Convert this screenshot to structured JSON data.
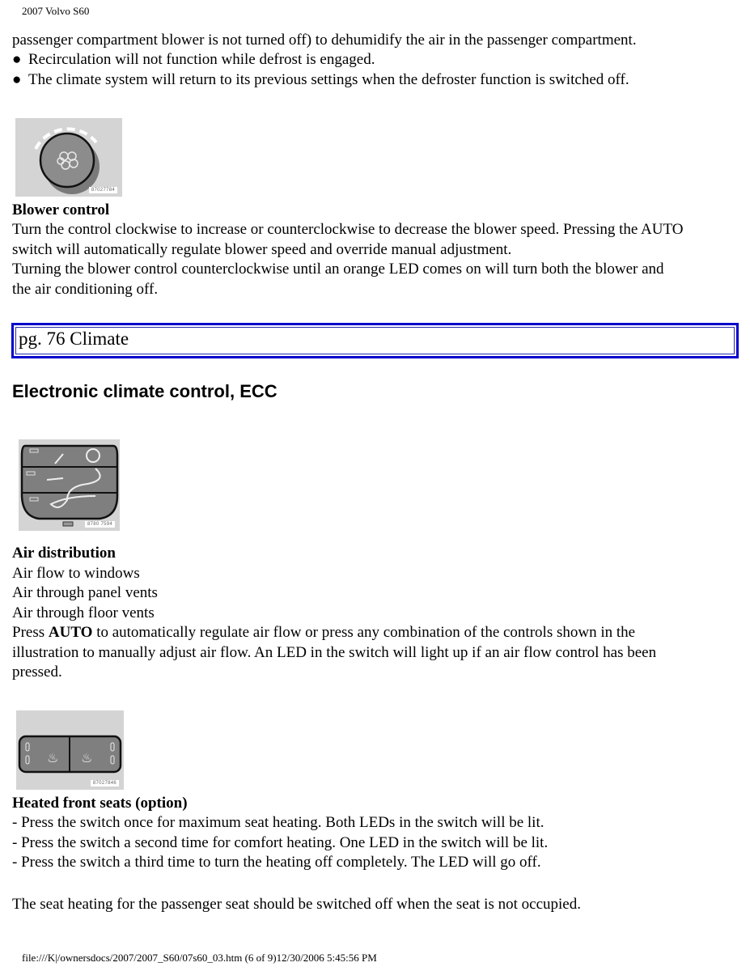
{
  "header": {
    "title": "2007 Volvo S60"
  },
  "intro": {
    "continuation": "passenger compartment blower is not turned off) to dehumidify the air in the passenger compartment.",
    "bullets": [
      "Recirculation will not function while defrost is engaged.",
      "The climate system will return to its previous settings when the defroster function is switched off."
    ]
  },
  "blower": {
    "image_code": "87027784",
    "heading": "Blower control",
    "lines": [
      "Turn the control clockwise to increase or counterclockwise to decrease the blower speed. Pressing the AUTO",
      "switch will automatically regulate blower speed and override manual adjustment.",
      "Turning the blower control counterclockwise until an orange LED comes on will turn both the blower and",
      "the air conditioning off."
    ]
  },
  "page_marker": {
    "label": "pg. 76 Climate"
  },
  "ecc": {
    "heading": "Electronic climate control, ECC"
  },
  "air": {
    "image_code": "8780 7594",
    "heading": "Air distribution",
    "items": [
      "Air flow to windows",
      "Air through panel vents",
      "Air through floor vents"
    ],
    "press_prefix": "Press ",
    "press_bold": "AUTO",
    "press_rest": " to automatically regulate air flow or press any combination of the controls shown in the",
    "line2": "illustration to manually adjust air flow. An LED in the switch will light up if an air flow control has been",
    "line3": "pressed."
  },
  "seats": {
    "image_code": "87027846",
    "heading": "Heated front seats (option)",
    "steps": [
      "- Press the switch once for maximum seat heating. Both LEDs in the switch will be lit.",
      "- Press the switch a second time for comfort heating. One LED in the switch will be lit.",
      "- Press the switch a third time to turn the heating off completely. The LED will go off."
    ],
    "note": "The seat heating for the passenger seat should be switched off when the seat is not occupied."
  },
  "footer": {
    "text": "file:///K|/ownersdocs/2007/2007_S60/07s60_03.htm (6 of 9)12/30/2006 5:45:56 PM"
  }
}
